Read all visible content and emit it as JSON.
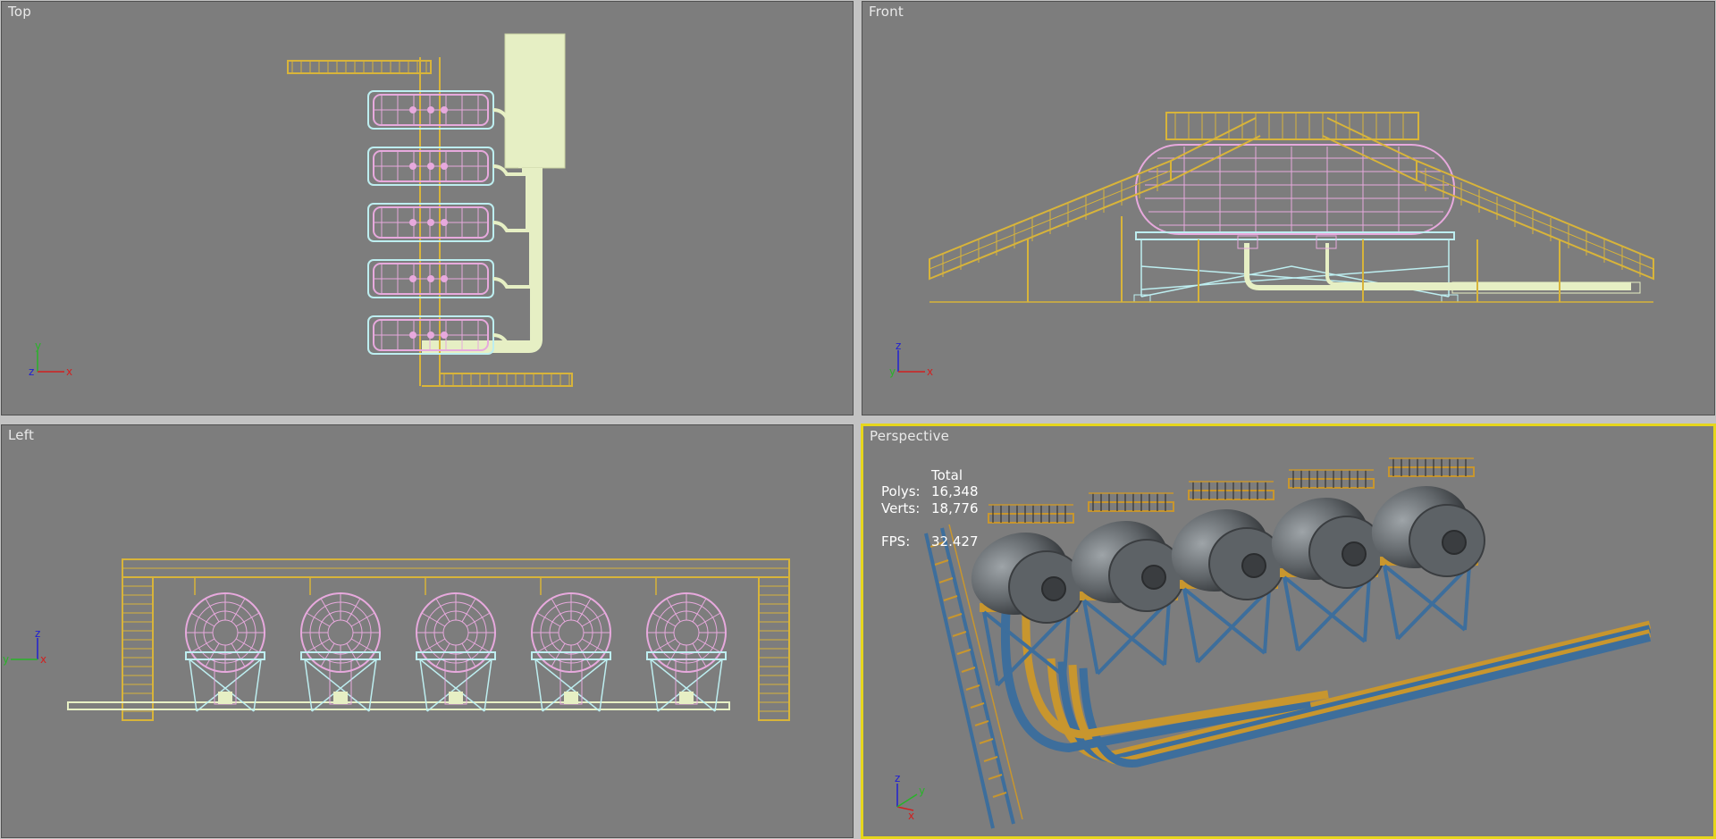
{
  "viewports": {
    "top": {
      "label": "Top",
      "axes": {
        "v": "y",
        "h": "x",
        "c": "z"
      }
    },
    "front": {
      "label": "Front",
      "axes": {
        "v": "z",
        "h": "x",
        "c": "y"
      }
    },
    "left": {
      "label": "Left",
      "axes": {
        "v": "z",
        "h": "y",
        "c": "x"
      }
    },
    "perspective": {
      "label": "Perspective",
      "axes": {
        "v": "z",
        "h": "x",
        "c": "y"
      }
    }
  },
  "stats": {
    "header": "Total",
    "polys_label": "Polys:",
    "polys_value": "16,348",
    "verts_label": "Verts:",
    "verts_value": "18,776",
    "fps_label": "FPS:",
    "fps_value": "32.427"
  },
  "colors": {
    "viewport_bg": "#7d7d7d",
    "active_border": "#e6d61c",
    "wire_yellow": "#d8b43a",
    "wire_pink": "#e7a9dd",
    "wire_cyan": "#bdeef0",
    "wire_cream": "#e6efc4",
    "pipe_blue": "#3d6e9c",
    "pipe_orange": "#c8962e",
    "tank_gray": "#5f6468"
  },
  "icons": [
    "axis-tripod-icon"
  ]
}
